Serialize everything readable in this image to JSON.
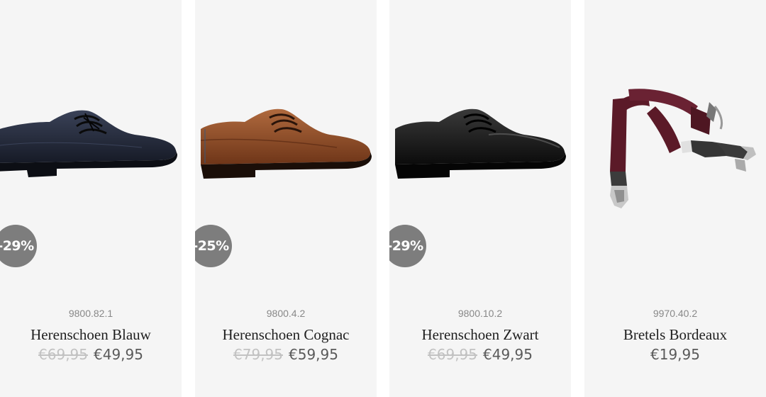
{
  "products": [
    {
      "badge": "-29%",
      "sku": "9800.82.1",
      "name": "Herenschoen Blauw",
      "old_price": "€69,95",
      "price": "€49,95",
      "image": "navy-derby-shoe",
      "color": "#1e2333"
    },
    {
      "badge": "-25%",
      "sku": "9800.4.2",
      "name": "Herenschoen Cognac",
      "old_price": "€79,95",
      "price": "€59,95",
      "image": "cognac-derby-shoe",
      "color": "#8a4a28"
    },
    {
      "badge": "-29%",
      "sku": "9800.10.2",
      "name": "Herenschoen Zwart",
      "old_price": "€69,95",
      "price": "€49,95",
      "image": "black-derby-shoe",
      "color": "#141414"
    },
    {
      "sku": "9970.40.2",
      "name": "Bretels Bordeaux",
      "price": "€19,95",
      "image": "bordeaux-suspenders",
      "color": "#5b1a28"
    }
  ],
  "colors": {
    "badge_bg": "#7d7d7d",
    "card_bg": "#f5f5f5",
    "old_price": "#c2c2c2",
    "price": "#5a5a5a"
  }
}
